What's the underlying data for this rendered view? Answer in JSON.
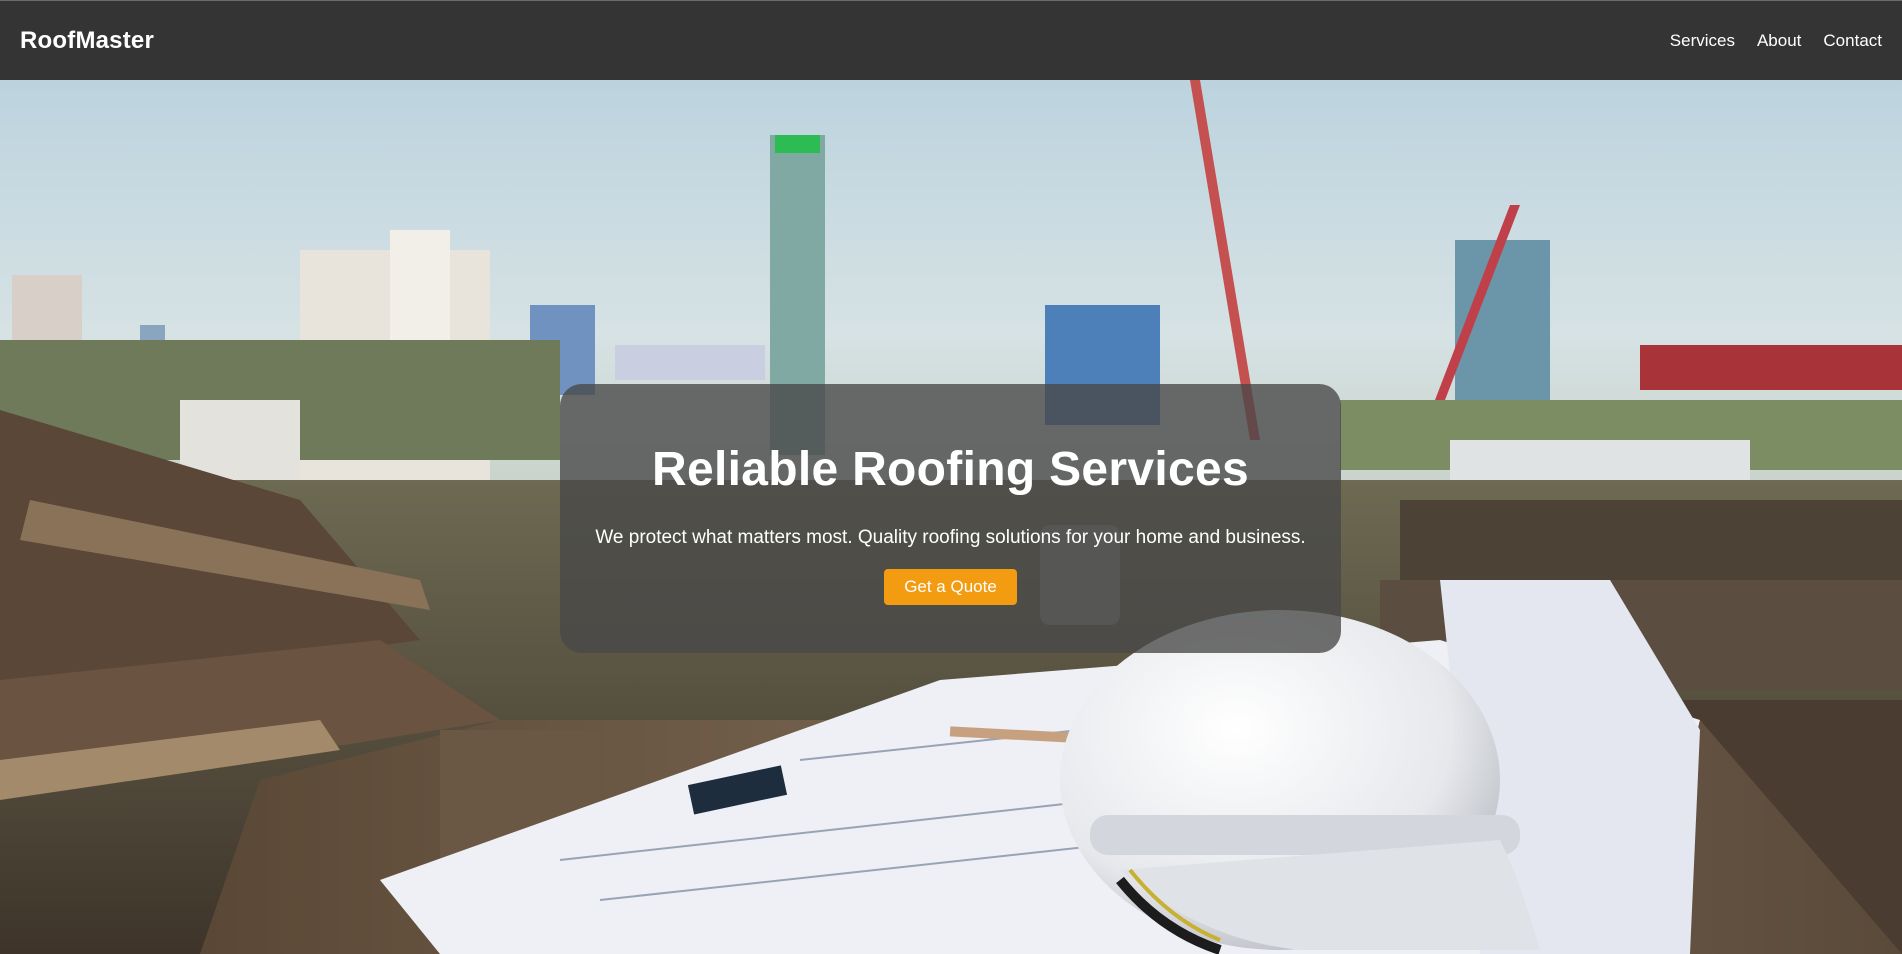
{
  "header": {
    "logo": "RoofMaster",
    "nav": [
      "Services",
      "About",
      "Contact"
    ]
  },
  "hero": {
    "title": "Reliable Roofing Services",
    "subtitle": "We protect what matters most. Quality roofing solutions for your home and business.",
    "cta_label": "Get a Quote",
    "background_image": "construction-site-hardhat-blueprints-photo"
  },
  "colors": {
    "header_bg": "#343434",
    "cta_bg": "#f39c12",
    "text": "#ffffff"
  }
}
